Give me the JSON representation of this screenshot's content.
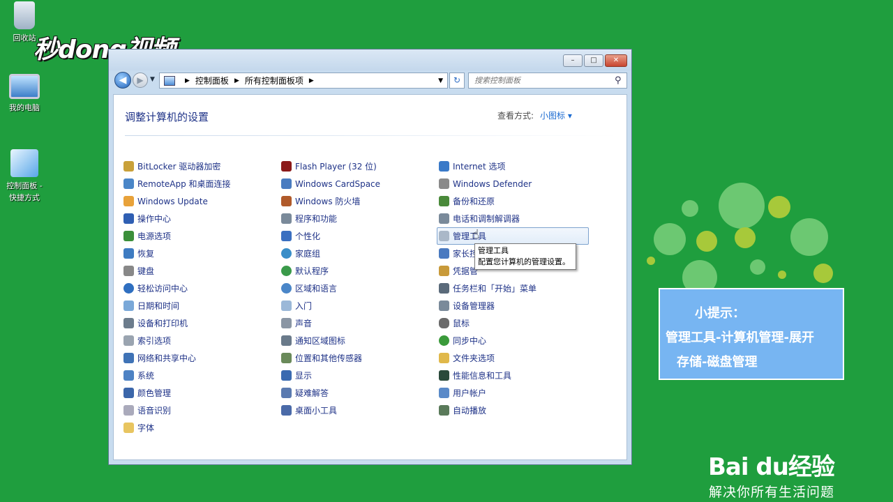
{
  "desktop": {
    "icons": [
      {
        "label": "回收站"
      },
      {
        "label": "我的电脑"
      },
      {
        "label_line1": "控制面板 -",
        "label_line2": "快捷方式"
      }
    ],
    "watermark": "秒dong视频"
  },
  "window": {
    "controls": {
      "minimize": "–",
      "maximize": "□",
      "close": "✕"
    },
    "address": {
      "crumbs": [
        "控制面板",
        "所有控制面板项"
      ]
    },
    "search_placeholder": "搜索控制面板",
    "heading": "调整计算机的设置",
    "view_by_label": "查看方式:",
    "view_by_value": "小图标 ▾",
    "columns": [
      [
        "BitLocker 驱动器加密",
        "RemoteApp 和桌面连接",
        "Windows Update",
        "操作中心",
        "电源选项",
        "恢复",
        "键盘",
        "轻松访问中心",
        "日期和时间",
        "设备和打印机",
        "索引选项",
        "网络和共享中心",
        "系统",
        "颜色管理",
        "语音识别",
        "字体"
      ],
      [
        "Flash Player (32 位)",
        "Windows CardSpace",
        "Windows 防火墙",
        "程序和功能",
        "个性化",
        "家庭组",
        "默认程序",
        "区域和语言",
        "入门",
        "声音",
        "通知区域图标",
        "位置和其他传感器",
        "显示",
        "疑难解答",
        "桌面小工具"
      ],
      [
        "Internet 选项",
        "Windows Defender",
        "备份和还原",
        "电话和调制解调器",
        "管理工具",
        "家长控",
        "凭据管",
        "任务栏和「开始」菜单",
        "设备管理器",
        "鼠标",
        "同步中心",
        "文件夹选项",
        "性能信息和工具",
        "用户帐户",
        "自动播放"
      ]
    ],
    "hovered_item": "管理工具",
    "tooltip": {
      "title": "管理工具",
      "description": "配置您计算机的管理设置。"
    }
  },
  "hint": {
    "title": "小提示：",
    "line1": "管理工具-计算机管理-展开",
    "line2": "存储-磁盘管理"
  },
  "brand": {
    "logo": "Bai du经验",
    "slogan": "解决你所有生活问题"
  },
  "colors": {
    "desktop_bg": "#1f9e3e",
    "link_text": "#1e3287",
    "hint_bg": "#77b5f2"
  }
}
